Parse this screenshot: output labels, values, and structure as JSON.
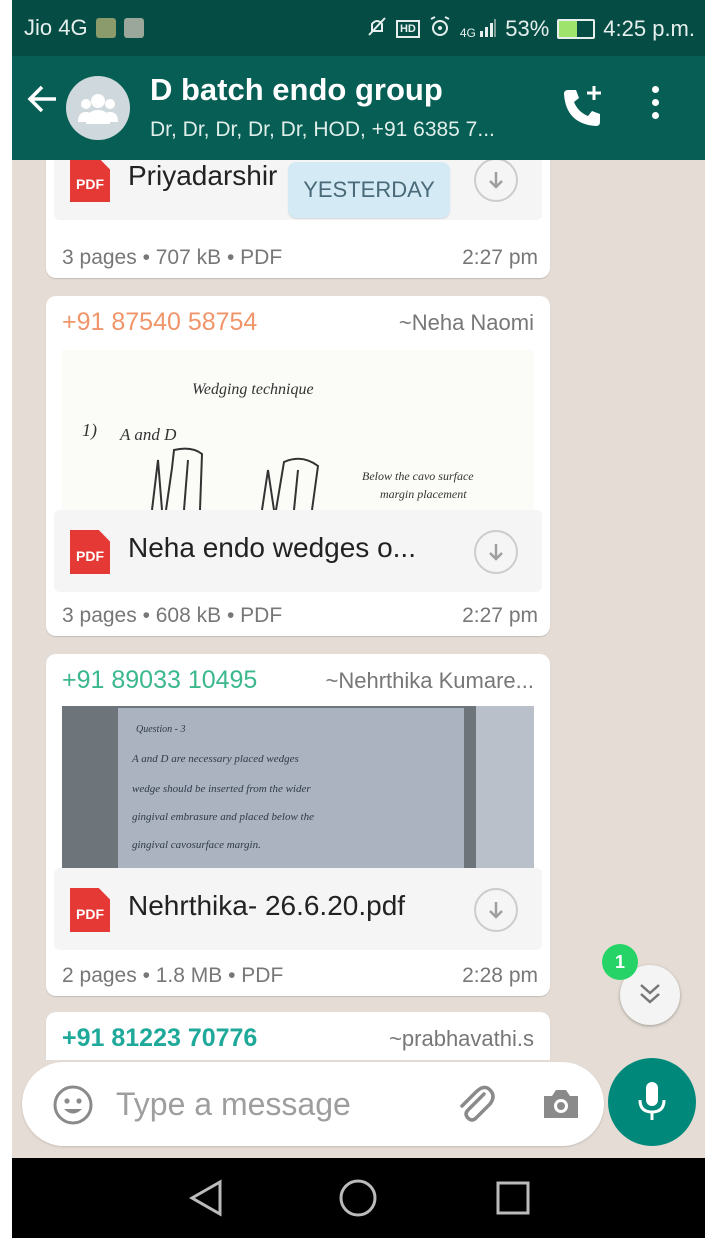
{
  "status_bar": {
    "carrier": "Jio 4G",
    "network": "4G",
    "battery": "53%",
    "battery_level": 0.53,
    "time": "4:25 p.m."
  },
  "header": {
    "title": "D batch endo group",
    "subtitle": "Dr, Dr, Dr, Dr, Dr, HOD, +91 6385 7..."
  },
  "chat": {
    "date_chip": "YESTERDAY",
    "messages": [
      {
        "file_name": "Priyadarshir",
        "file_icon": "PDF",
        "meta": "3 pages • 707 kB • PDF",
        "time": "2:27 pm"
      },
      {
        "sender": "+91 87540 58754",
        "alias": "~Neha Naomi",
        "preview_text": [
          "Wedging technique",
          "1)",
          "A and D",
          "Below the cavo surface",
          "margin placement"
        ],
        "file_name": "Neha endo wedges o...",
        "file_icon": "PDF",
        "meta": "3 pages • 608 kB • PDF",
        "time": "2:27 pm"
      },
      {
        "sender": "+91 89033 10495",
        "alias": "~Nehrthika Kumare...",
        "preview_text": [
          "Question - 3",
          "A and D are necessary placed wedges",
          "wedge should be inserted from the wider",
          "gingival embrasure and placed below the",
          "gingival cavosurface margin."
        ],
        "file_name": "Nehrthika- 26.6.20.pdf",
        "file_icon": "PDF",
        "meta": "2 pages • 1.8 MB • PDF",
        "time": "2:28 pm"
      },
      {
        "sender": "+91 81223 70776",
        "alias": "~prabhavathi.s"
      }
    ],
    "unread_count": "1"
  },
  "composer": {
    "placeholder": "Type a message"
  },
  "colors": {
    "header": "#075e54",
    "status_bar": "#054d44",
    "accent": "#00897b",
    "sender_orange": "#f0956a",
    "sender_green": "#3bb88c",
    "sender_teal": "#1fa99a"
  }
}
